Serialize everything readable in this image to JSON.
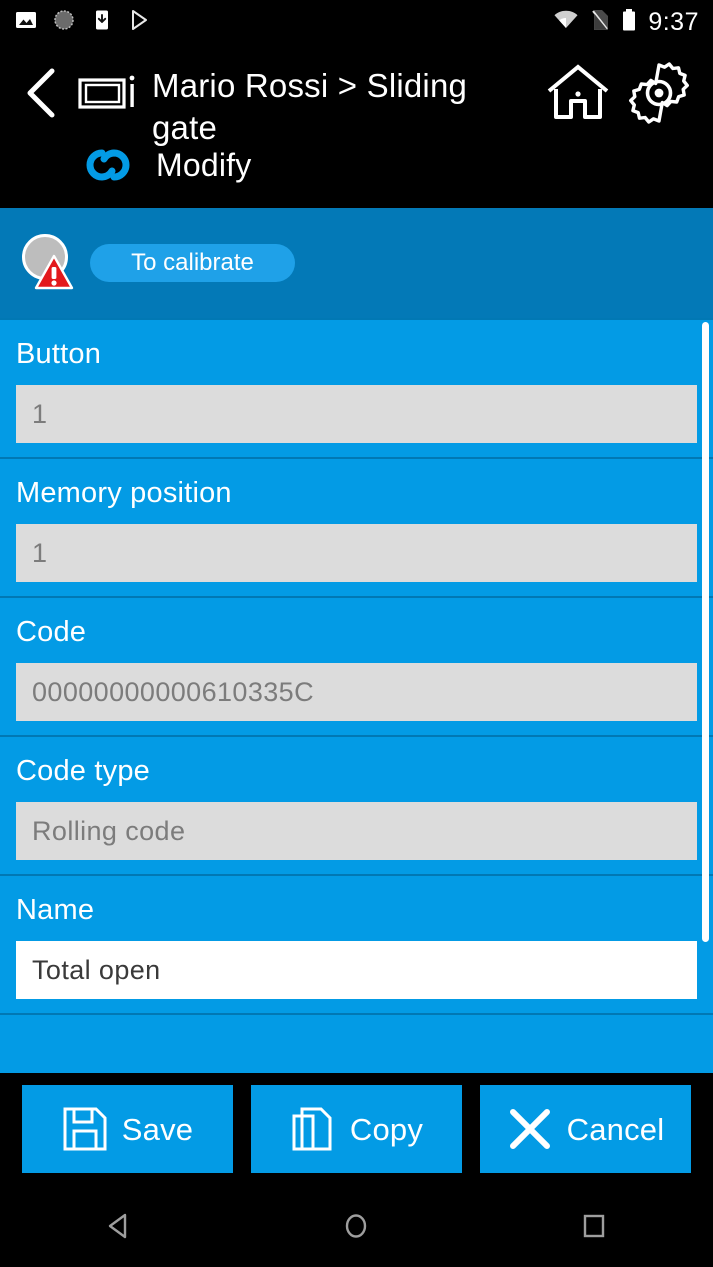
{
  "statusbar": {
    "icons_left": [
      "image-icon",
      "screenshot-icon",
      "download-icon",
      "play-store-icon"
    ],
    "icons_right": [
      "wifi-icon",
      "no-sim-icon",
      "battery-icon"
    ],
    "clock": "9:37"
  },
  "header": {
    "back_icon": "back-chevron-icon",
    "device_icon": "device-info-icon",
    "title": "Mario Rossi > Sliding gate",
    "home_icon": "home-icon",
    "settings_icon": "gear-icon",
    "mode_icon": "modify-cycle-icon",
    "mode_label": "Modify"
  },
  "status_band": {
    "icon": "warning-circle-icon",
    "badge_label": "To calibrate",
    "badge_color": "#1fa1e8",
    "band_color": "#0379b7"
  },
  "form": {
    "accent_color": "#039be5",
    "fields": [
      {
        "label": "Button",
        "value": "1",
        "editable": false
      },
      {
        "label": "Memory position",
        "value": "1",
        "editable": false
      },
      {
        "label": "Code",
        "value": "00000000000610335C",
        "editable": false
      },
      {
        "label": "Code type",
        "value": "Rolling code",
        "editable": false
      },
      {
        "label": "Name",
        "value": "Total open",
        "editable": true
      }
    ]
  },
  "actions": [
    {
      "label": "Save",
      "icon": "save-floppy-icon"
    },
    {
      "label": "Copy",
      "icon": "copy-pages-icon"
    },
    {
      "label": "Cancel",
      "icon": "close-x-icon"
    }
  ],
  "navbar": {
    "back": "nav-back-icon",
    "home": "nav-home-icon",
    "recents": "nav-recents-icon"
  }
}
